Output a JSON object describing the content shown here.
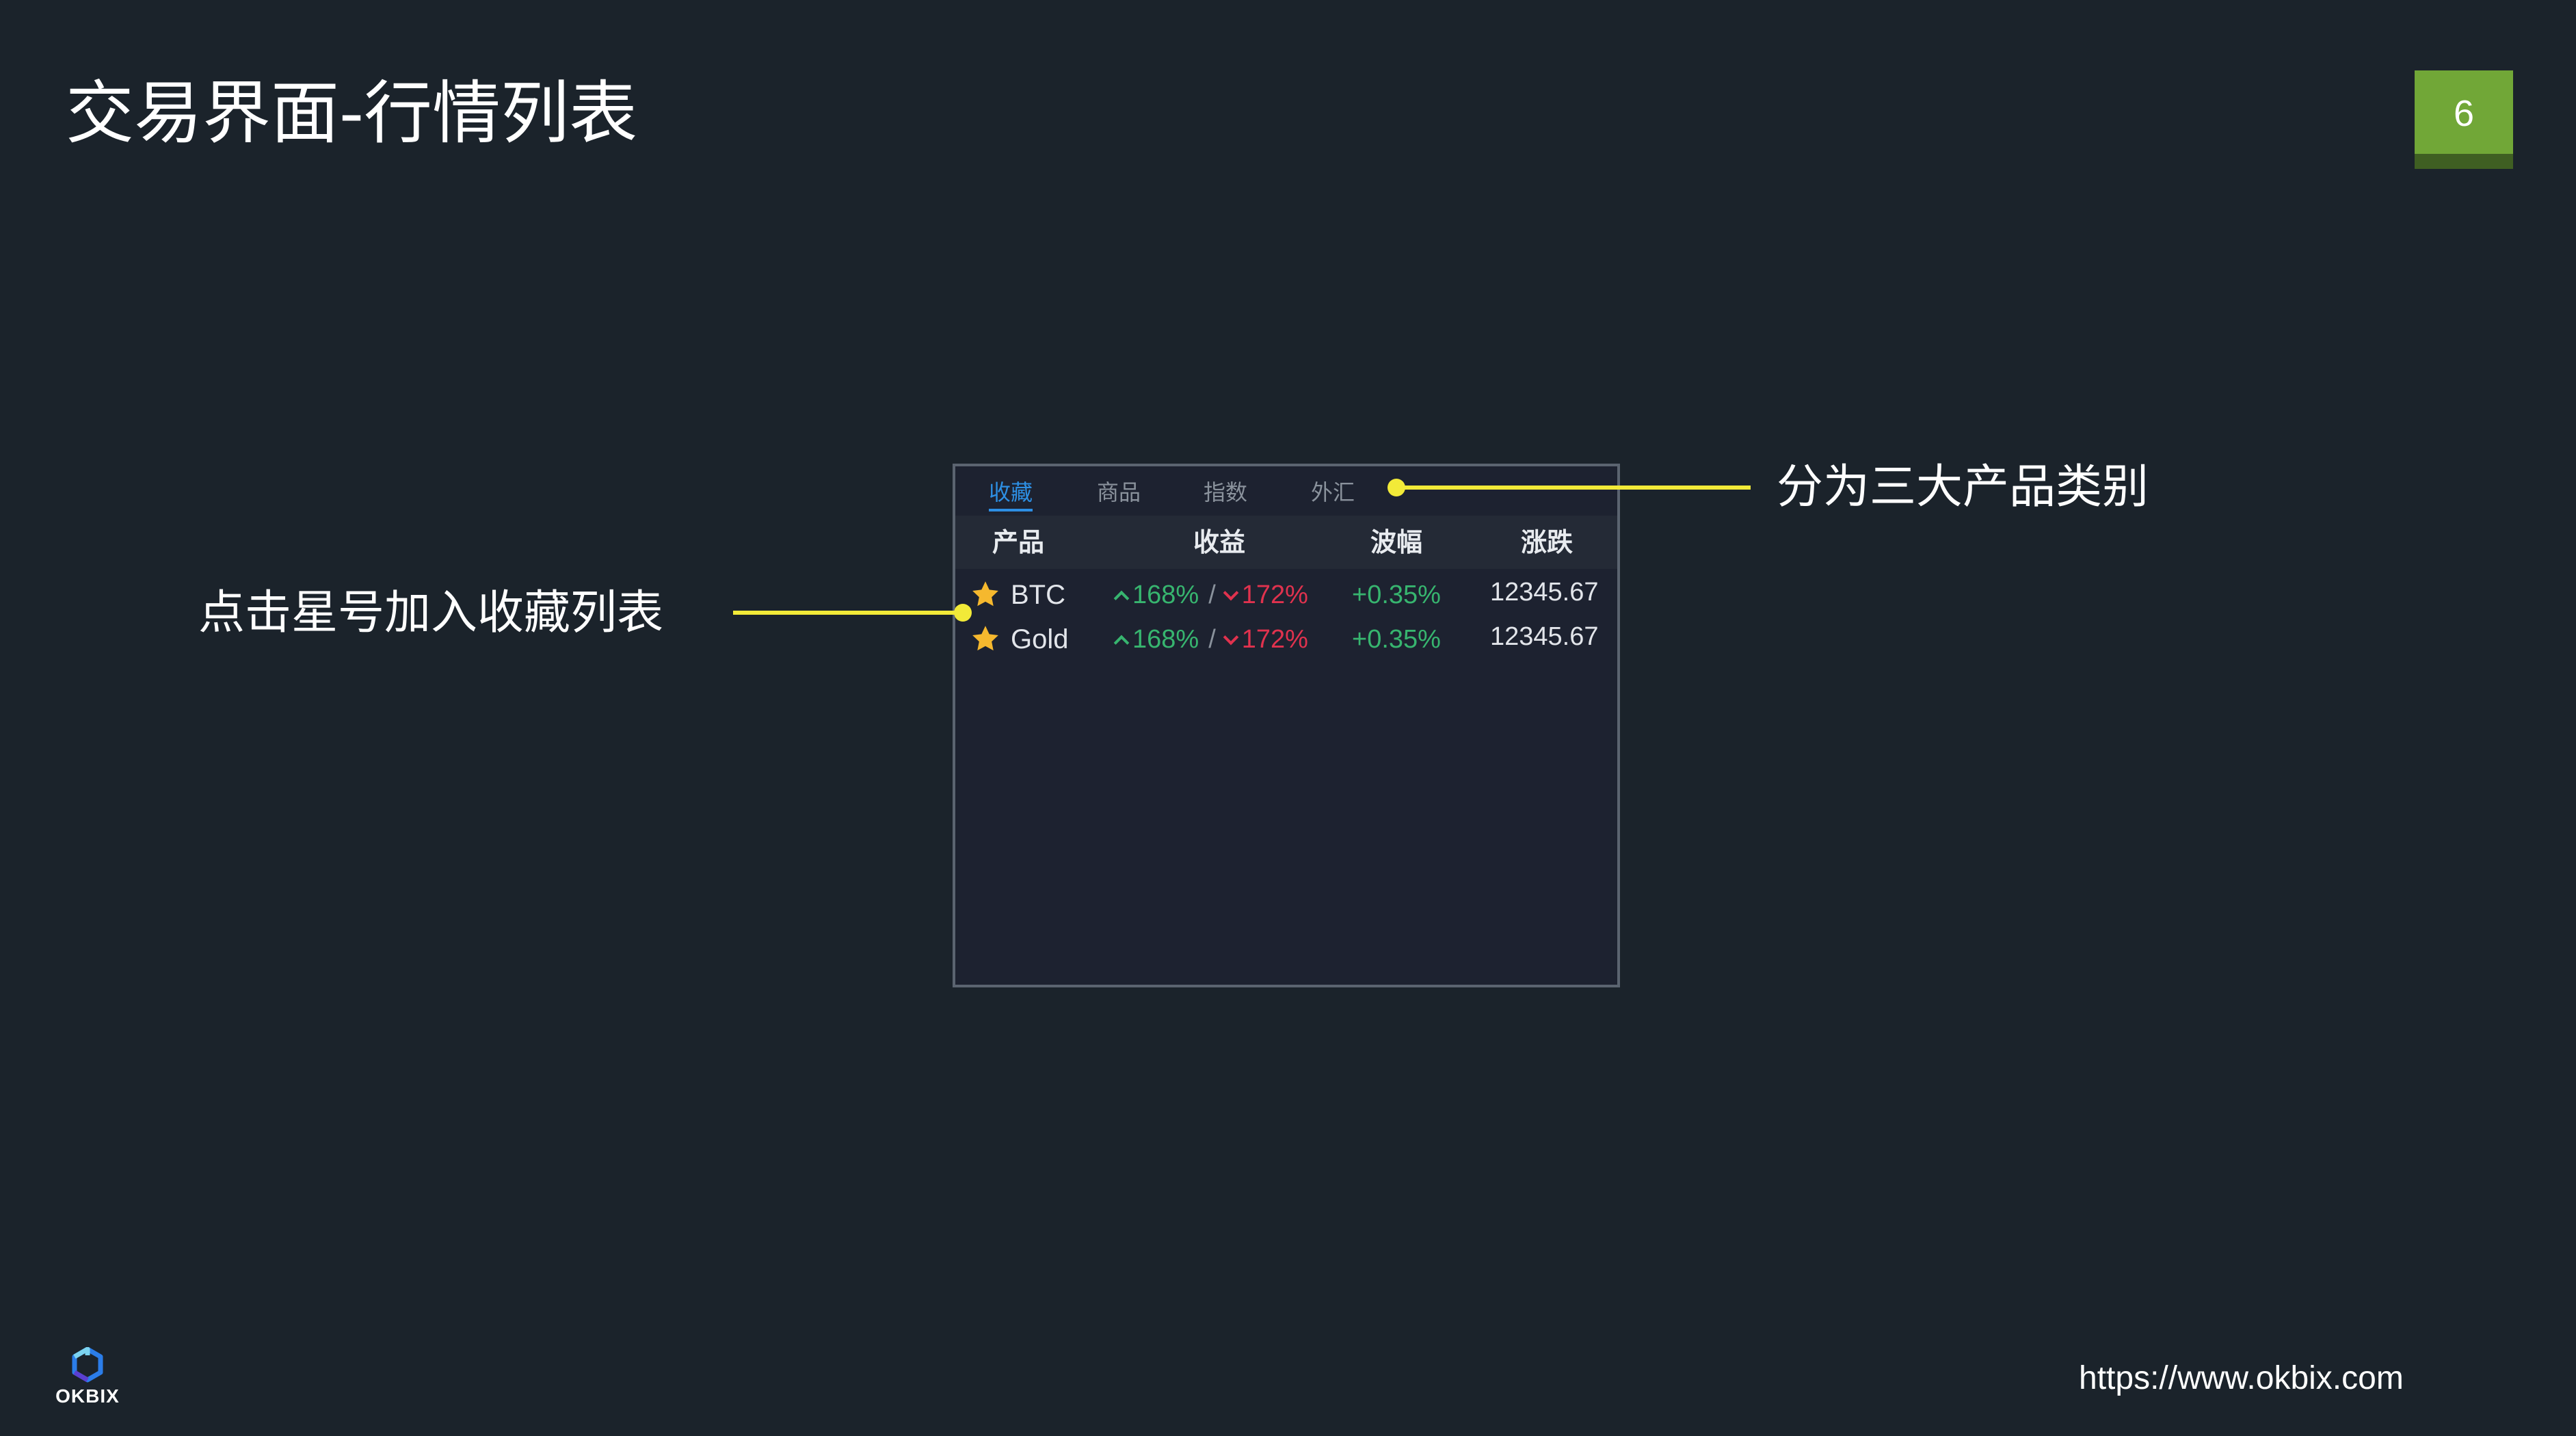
{
  "slide": {
    "title": "交易界面-行情列表",
    "page_number": "6"
  },
  "panel": {
    "tabs": [
      {
        "label": "收藏",
        "active": true
      },
      {
        "label": "商品",
        "active": false
      },
      {
        "label": "指数",
        "active": false
      },
      {
        "label": "外汇",
        "active": false
      }
    ],
    "columns": [
      "产品",
      "收益",
      "波幅",
      "涨跌"
    ],
    "rows": [
      {
        "icon": "star-icon",
        "name": "BTC",
        "yield_up": "168%",
        "separator": "/",
        "yield_down": "172%",
        "amplitude": "+0.35%",
        "price": "12345.67"
      },
      {
        "icon": "star-icon",
        "name": "Gold",
        "yield_up": "168%",
        "separator": "/",
        "yield_down": "172%",
        "amplitude": "+0.35%",
        "price": "12345.67"
      }
    ]
  },
  "callouts": {
    "categories": "分为三大产品类别",
    "favorites": "点击星号加入收藏列表"
  },
  "footer": {
    "logo_text": "OKBIX",
    "url": "https://www.okbix.com"
  },
  "colors": {
    "background": "#1b232b",
    "accent_blue": "#2d8fe3",
    "up_green": "#37b56f",
    "down_red": "#e0324e",
    "callout_yellow": "#f2ea38",
    "badge_green": "#71a737",
    "star_gold": "#f5b82e"
  }
}
